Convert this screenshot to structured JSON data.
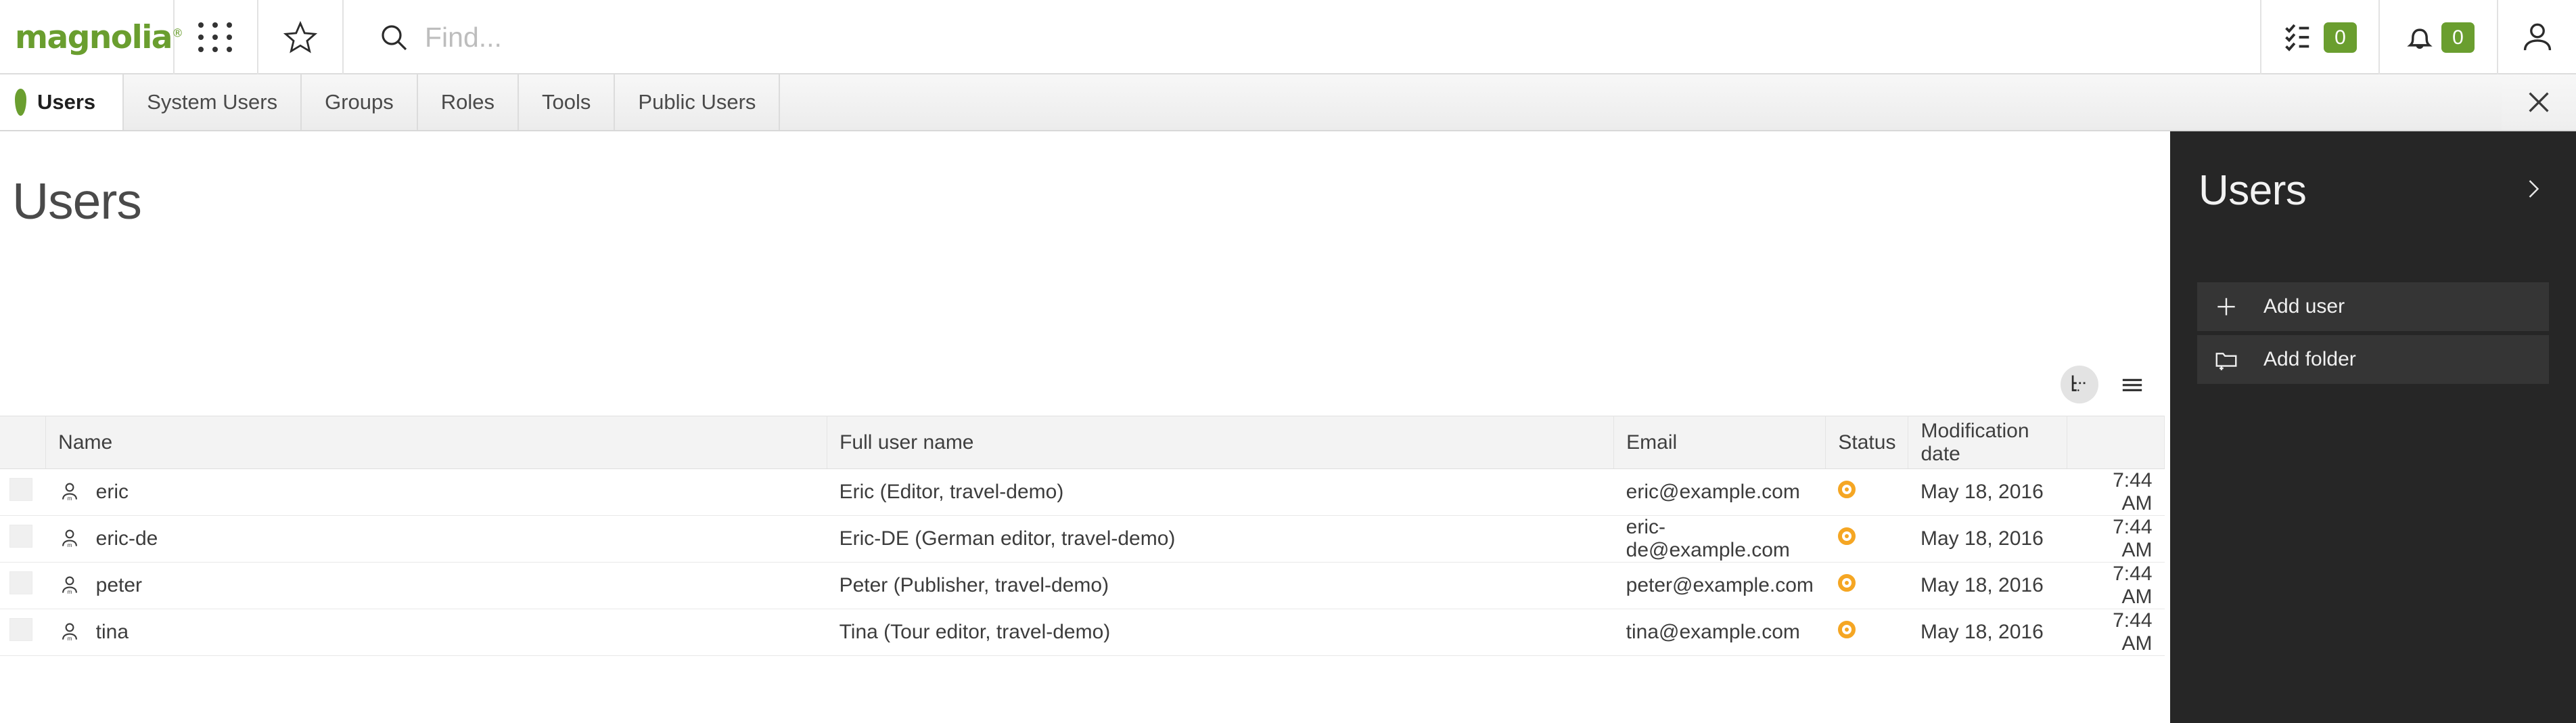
{
  "header": {
    "logo_text": "magnolia",
    "logo_mark": "®",
    "apps_icon": "apps-grid-icon",
    "favorites_icon": "star-icon",
    "search": {
      "placeholder": "Find...",
      "value": "",
      "icon": "search-icon"
    },
    "tasks": {
      "icon": "tasks-checklist-icon",
      "count": "0"
    },
    "notifications": {
      "icon": "bell-icon",
      "count": "0"
    },
    "user": {
      "icon": "user-avatar-icon"
    },
    "brand_green": "#6a9e2f"
  },
  "tabs": [
    {
      "label": "Users",
      "active": true
    },
    {
      "label": "System Users",
      "active": false
    },
    {
      "label": "Groups",
      "active": false
    },
    {
      "label": "Roles",
      "active": false
    },
    {
      "label": "Tools",
      "active": false
    },
    {
      "label": "Public Users",
      "active": false
    }
  ],
  "tabbar": {
    "close_icon": "close-icon"
  },
  "main": {
    "page_title": "Users",
    "view_toggles": [
      {
        "name": "tree-view-icon",
        "active": true
      },
      {
        "name": "list-view-icon",
        "active": false
      }
    ],
    "table": {
      "columns": [
        "Name",
        "Full user name",
        "Email",
        "Status",
        "Modification date"
      ],
      "rows": [
        {
          "name": "eric",
          "full_name": "Eric (Editor, travel-demo)",
          "email": "eric@example.com",
          "status": "activated",
          "status_color": "#f5a623",
          "date": "May 18, 2016",
          "time": "7:44 AM"
        },
        {
          "name": "eric-de",
          "full_name": "Eric-DE (German editor, travel-demo)",
          "email": "eric-de@example.com",
          "status": "activated",
          "status_color": "#f5a623",
          "date": "May 18, 2016",
          "time": "7:44 AM"
        },
        {
          "name": "peter",
          "full_name": "Peter (Publisher, travel-demo)",
          "email": "peter@example.com",
          "status": "activated",
          "status_color": "#f5a623",
          "date": "May 18, 2016",
          "time": "7:44 AM"
        },
        {
          "name": "tina",
          "full_name": "Tina (Tour editor, travel-demo)",
          "email": "tina@example.com",
          "status": "activated",
          "status_color": "#f5a623",
          "date": "May 18, 2016",
          "time": "7:44 AM"
        }
      ]
    }
  },
  "action_panel": {
    "title": "Users",
    "collapse_icon": "chevron-right-icon",
    "background": "#262626",
    "actions": [
      {
        "label": "Add user",
        "icon": "plus-icon"
      },
      {
        "label": "Add folder",
        "icon": "folder-add-icon"
      }
    ]
  }
}
